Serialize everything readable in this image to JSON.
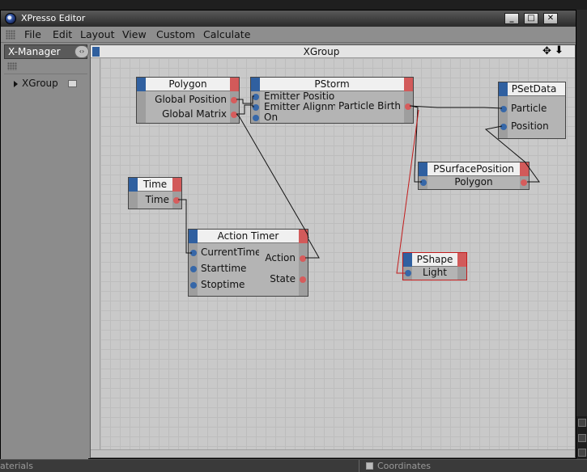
{
  "window": {
    "title": "XPresso Editor",
    "minimize": "_",
    "maximize": "□",
    "close": "✕"
  },
  "menu": [
    "File",
    "Edit",
    "Layout",
    "View",
    "Custom",
    "Calculate"
  ],
  "xmanager": {
    "title": "X-Manager",
    "nav": "‹›",
    "items": [
      {
        "label": "XGroup"
      }
    ]
  },
  "editor": {
    "title": "XGroup",
    "move_icon": "✥",
    "arrow_icon": "⬇"
  },
  "nodes": {
    "polygon": {
      "title": "Polygon",
      "outputs": [
        "Global Position",
        "Global Matrix"
      ]
    },
    "pstorm": {
      "title": "PStorm",
      "inputs": [
        "Emitter Position",
        "Emitter Alignme",
        "On"
      ],
      "outputs": [
        "Particle Birth"
      ]
    },
    "psetdata": {
      "title": "PSetData",
      "inputs": [
        "Particle",
        "Position"
      ]
    },
    "psurface": {
      "title": "PSurfacePosition",
      "inputs": [
        "Polygon"
      ]
    },
    "time": {
      "title": "Time",
      "outputs": [
        "Time"
      ]
    },
    "actiontimer": {
      "title": "Action Timer",
      "inputs": [
        "CurrentTime",
        "Starttime",
        "Stoptime"
      ],
      "outputs": [
        "Action",
        "State"
      ]
    },
    "pshape": {
      "title": "PShape",
      "inputs": [
        "Light"
      ]
    }
  },
  "background": {
    "left_label": "aterials",
    "right_label": "Coordinates"
  },
  "colors": {
    "input_port": "#3667a8",
    "output_port": "#d65c5c",
    "selected_wire": "#c21c1c"
  }
}
